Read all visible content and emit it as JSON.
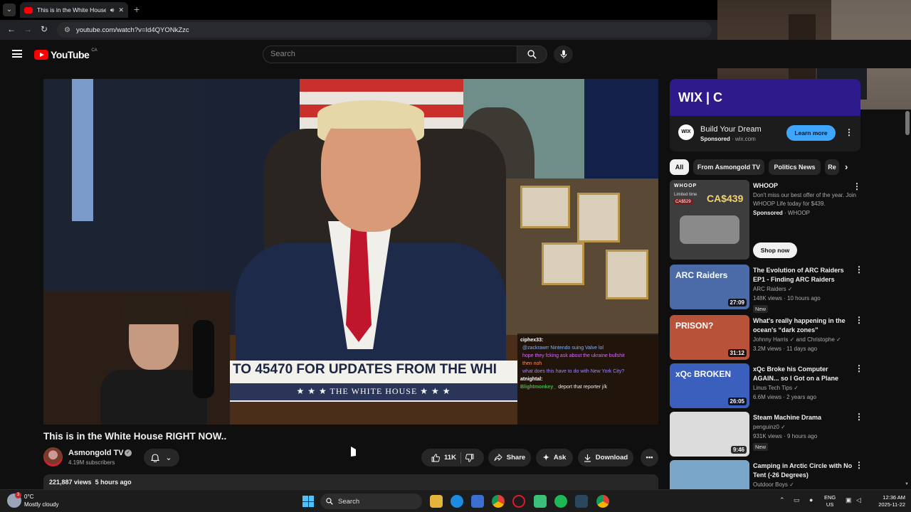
{
  "browser": {
    "tab_title": "This is in the White House RIGHT NOW..",
    "url": "youtube.com/watch?v=Id4QYONkZzc",
    "new_tab": "+"
  },
  "header": {
    "logo_text": "YouTube",
    "country_code": "CA",
    "search_placeholder": "Search"
  },
  "video": {
    "banner_text": "TO 45470 FOR UPDATES FROM THE WHI",
    "banner_sub": "★ ★ ★   THE WHITE HOUSE   ★ ★ ★",
    "title": "This is in the White House RIGHT NOW..",
    "channel": "Asmongold TV",
    "subscribers": "4.19M subscribers",
    "likes": "11K",
    "share": "Share",
    "ask": "Ask",
    "download": "Download",
    "views": "221,887 views",
    "posted": "5 hours ago"
  },
  "chat": [
    {
      "user": "ciphex33:",
      "msg": "",
      "color": "#ffffff"
    },
    {
      "user": "",
      "msg": "@zackrawrr Nintendo suing Valve lol",
      "color": "#7fb3ff"
    },
    {
      "user": "",
      "msg": "hope they fcking ask about the ukraine bullshit",
      "color": "#d86bff"
    },
    {
      "user": "",
      "msg": "then noh",
      "color": "#ff8a65"
    },
    {
      "user": "",
      "msg": "what does this have to do with New York City?",
      "color": "#9c88ff"
    },
    {
      "user": "atnightal:",
      "msg": "",
      "color": "#ffffff"
    },
    {
      "user": "Blightmonkey_",
      "msg": "deport that reporter j/k",
      "color": "#4caf50"
    }
  ],
  "ad": {
    "brand": "WIX | C",
    "logo": "WIX",
    "title": "Build Your Dream",
    "sponsored": "Sponsored",
    "domain": "wix.com",
    "cta": "Learn more"
  },
  "chips": [
    "All",
    "From Asmongold TV",
    "Politics News",
    "Re"
  ],
  "promo": {
    "title": "WHOOP",
    "desc": "Don't miss our best offer of the year. Join WHOOP Life today for $439.",
    "sponsored": "Sponsored",
    "advertiser": "WHOOP",
    "cta": "Shop now",
    "thumb_brand": "WHOOP",
    "thumb_price": "CA$439",
    "thumb_old": "CA$529",
    "thumb_label": "Limited time"
  },
  "recommendations": [
    {
      "title": "The Evolution of ARC Raiders EP1 - Finding ARC Raiders",
      "channel": "ARC Raiders",
      "meta": "148K views · 10 hours ago",
      "badge": "New",
      "duration": "27:09",
      "thumb_text": "ARC Raiders",
      "thumb_color": "#4a6aa8"
    },
    {
      "title": "What's really happening in the ocean's “dark zones”",
      "channel": "Johnny Harris",
      "channel2": "and Christophe",
      "meta": "3.2M views · 11 days ago",
      "badge": "",
      "duration": "31:12",
      "thumb_text": "PRISON?",
      "thumb_color": "#b8533a"
    },
    {
      "title": "xQc Broke his Computer AGAIN... so I Got on a Plane",
      "channel": "Linus Tech Tips",
      "meta": "6.6M views · 2 years ago",
      "badge": "",
      "duration": "26:05",
      "thumb_text": "xQc BROKEN",
      "thumb_color": "#3a5fbd"
    },
    {
      "title": "Steam Machine Drama",
      "channel": "penguinz0",
      "meta": "931K views · 9 hours ago",
      "badge": "New",
      "duration": "9:46",
      "thumb_text": "",
      "thumb_color": "#dcdcdc"
    },
    {
      "title": "Camping in Arctic Circle with No Tent (-26 Degrees)",
      "channel": "Outdoor Boys",
      "meta": "",
      "badge": "",
      "duration": "",
      "thumb_text": "",
      "thumb_color": "#7aa6c9"
    }
  ],
  "taskbar": {
    "temp": "0°C",
    "weather": "Mostly cloudy",
    "weather_badge": "3",
    "search": "Search",
    "lang1": "ENG",
    "lang2": "US",
    "time": "12:36 AM",
    "date": "2025-11-22"
  },
  "icons": {
    "tab_menu": "chevron-down-icon",
    "back": "arrow-left-icon",
    "forward": "arrow-right-icon",
    "reload": "reload-icon",
    "site_info": "tune-icon",
    "search": "search-icon",
    "mic": "mic-icon",
    "bell": "bell-icon",
    "like": "thumb-up-icon",
    "dislike": "thumb-down-icon",
    "share": "share-icon",
    "ask": "sparkle-icon",
    "download": "download-icon",
    "more": "more-icon",
    "chevron_right": "chevron-right-icon"
  }
}
